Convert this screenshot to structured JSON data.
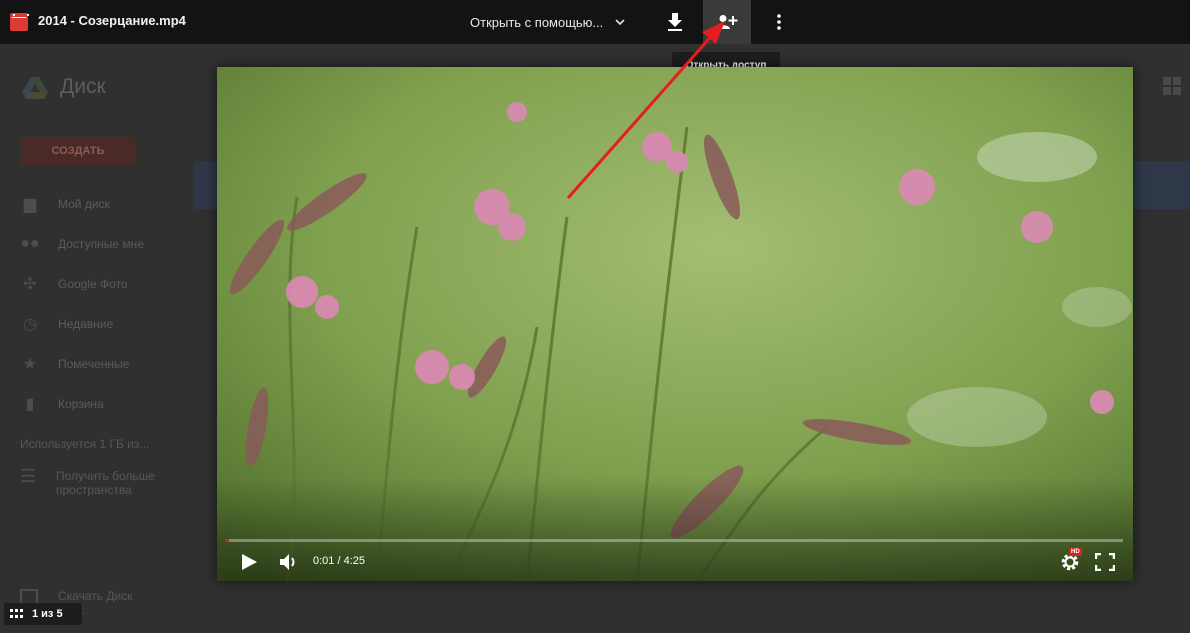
{
  "header": {
    "file_name": "2014 - Созерцание.mp4",
    "open_with_label": "Открыть с помощью...",
    "download_icon": "download-icon",
    "share_icon": "add-person-icon",
    "more_icon": "more-vert-icon"
  },
  "tooltip": {
    "text": "Открыть доступ"
  },
  "player": {
    "time_label": "0:01 / 4:25",
    "progress_fraction": 0.002,
    "hd_badge": "HD",
    "accent_color": "#e02020"
  },
  "pager": {
    "text": "1 из 5"
  },
  "background_drive": {
    "app_title": "Диск",
    "create_button": "СОЗДАТЬ",
    "nav": [
      {
        "label": "Мой диск",
        "icon": "folder-icon"
      },
      {
        "label": "Доступные мне",
        "icon": "people-icon"
      },
      {
        "label": "Google Фото",
        "icon": "photos-icon"
      },
      {
        "label": "Недавние",
        "icon": "clock-icon"
      },
      {
        "label": "Помеченные",
        "icon": "star-icon"
      },
      {
        "label": "Корзина",
        "icon": "trash-icon"
      }
    ],
    "usage_text": "Используется 1 ГБ из...",
    "more_storage": "Получить больше пространства",
    "download_pc": "Скачать Диск ...ПК"
  }
}
